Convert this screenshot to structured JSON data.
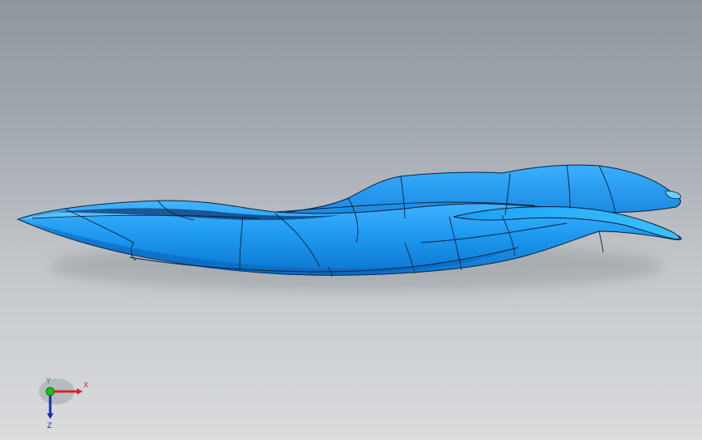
{
  "viewport": {
    "background_top": "#8e969e",
    "background_bottom": "#dadcde"
  },
  "model": {
    "name": "ray-shaped-body-surface",
    "face_color": "#1e9bf0",
    "highlight_color": "#5cc6ff",
    "shadow_color": "#0a5fb0",
    "edge_color": "#0b1e3a"
  },
  "triad": {
    "x_label": "X",
    "y_label": "Y",
    "z_label": "Z",
    "x_color": "#e02020",
    "y_color": "#10a010",
    "z_color": "#1a2aa8"
  }
}
